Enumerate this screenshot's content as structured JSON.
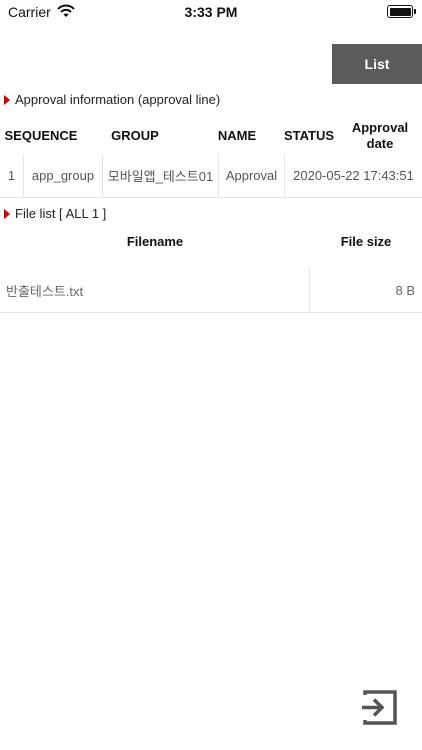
{
  "status_bar": {
    "carrier": "Carrier",
    "time": "3:33 PM",
    "wifi_icon": "wifi-icon",
    "battery_icon": "battery-icon"
  },
  "toolbar": {
    "list_label": "List",
    "list_color": "#5b5b5b"
  },
  "approval": {
    "title": "Approval information (approval line)",
    "columns": [
      "SEQUENCE",
      "GROUP",
      "NAME",
      "STATUS",
      "Approval date"
    ],
    "rows": [
      {
        "sequence": "1",
        "group": "app_group",
        "name": "모바일앱_테스트01",
        "status": "Approval",
        "date": "2020-05-22 17:43:51"
      }
    ]
  },
  "files": {
    "title": "File list [ ALL 1 ]",
    "columns": [
      "Filename",
      "File size"
    ],
    "rows": [
      {
        "name": "반출테스트.txt",
        "size": "8 B"
      }
    ]
  },
  "footer": {
    "exit_icon": "exit-icon"
  },
  "colors": {
    "accent_arrow": "#d40000",
    "divider": "#e4e4e4"
  }
}
